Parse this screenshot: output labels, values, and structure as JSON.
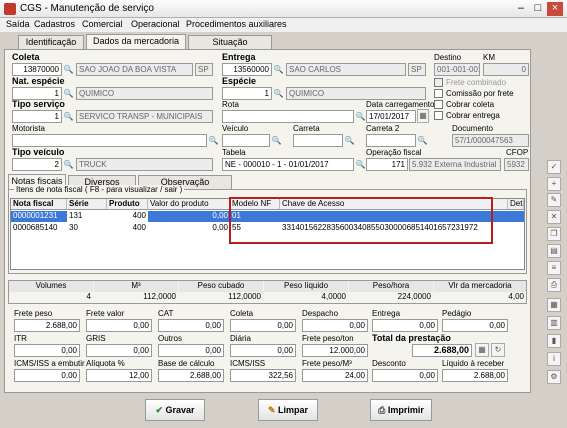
{
  "window": {
    "title": "CGS - Manutenção de serviço"
  },
  "menu": [
    "Saída",
    "Cadastros",
    "Comercial",
    "Operacional",
    "Procedimentos auxiliares"
  ],
  "tabs": [
    "Identificação",
    "Dados da mercadoria",
    "Situação"
  ],
  "coleta": {
    "label": "Coleta",
    "num": "13870000",
    "cidade": "SAO JOAO DA BOA VISTA",
    "uf": "SP"
  },
  "entrega": {
    "label": "Entrega",
    "num": "13560000",
    "cidade": "SAO CARLOS",
    "uf": "SP"
  },
  "destino": {
    "label": "Destino",
    "value": "001-001-001"
  },
  "km": {
    "label": "KM",
    "value": "0"
  },
  "nat_especie": {
    "label": "Nat. espécie",
    "code": "1",
    "value": "QUIMICO"
  },
  "especie": {
    "label": "Espécie",
    "code": "1",
    "value": "QUIMICO"
  },
  "checks": {
    "frete_combinado": "Frete combinado",
    "comissao": "Comissão por frete",
    "cobrar_coleta": "Cobrar coleta",
    "cobrar_entrega": "Cobrar entrega"
  },
  "tipo_servico": {
    "label": "Tipo serviço",
    "code": "1",
    "value": "SERVICO TRANSP - MUNICIPAIS"
  },
  "rota": {
    "label": "Rota"
  },
  "data_carregamento": {
    "label": "Data carregamento",
    "value": "17/01/2017"
  },
  "motorista": {
    "label": "Motorista"
  },
  "veiculo": {
    "label": "Veículo"
  },
  "carreta": {
    "label": "Carreta"
  },
  "carreta2": {
    "label": "Carreta 2"
  },
  "documento": {
    "label": "Documento",
    "value": "57/1/000047563"
  },
  "tipo_veiculo": {
    "label": "Tipo veículo",
    "code": "2",
    "value": "TRUCK"
  },
  "tabela": {
    "label": "Tabela",
    "value": "NE - 000010 - 1 - 01/01/2017"
  },
  "operacao_fiscal": {
    "label": "Operação fiscal",
    "code": "171",
    "value": "5.932 Externa Industrial 12"
  },
  "cfop": {
    "label": "CFOP",
    "value": "5932"
  },
  "subtabs": [
    "Notas fiscais",
    "Diversos",
    "Observação"
  ],
  "items_caption": "Itens de nota fiscal ( F8 - para visualizar / sair )",
  "grid": {
    "headers": [
      "Nota fiscal",
      "Série",
      "Produto",
      "Valor do produto",
      "Modelo NF",
      "Chave de Acesso",
      "Detalham"
    ],
    "rows": [
      [
        "0000001231",
        "131",
        "400",
        "0,00",
        "01",
        ""
      ],
      [
        "0000685140",
        "30",
        "400",
        "0,00",
        "55",
        "33140156228356003408550300006851401657231972"
      ]
    ]
  },
  "summary": {
    "headers": [
      "Volumes",
      "M³",
      "Peso cubado",
      "Peso líquido",
      "Peso/hora",
      "Vlr da mercadoria"
    ],
    "values": [
      "4",
      "112,0000",
      "112,0000",
      "4,0000",
      "224,0000",
      "4,00"
    ]
  },
  "values": {
    "row1": [
      {
        "label": "Frete peso",
        "value": "2.688,00"
      },
      {
        "label": "Frete valor",
        "value": "0,00"
      },
      {
        "label": "CAT",
        "value": "0,00"
      },
      {
        "label": "Coleta",
        "value": "0,00"
      },
      {
        "label": "Despacho",
        "value": "0,00"
      },
      {
        "label": "Entrega",
        "value": "0,00"
      },
      {
        "label": "Pedágio",
        "value": "0,00"
      }
    ],
    "row2": [
      {
        "label": "ITR",
        "value": "0,00"
      },
      {
        "label": "GRIS",
        "value": "0,00"
      },
      {
        "label": "Outros",
        "value": "0,00"
      },
      {
        "label": "Diária",
        "value": "0,00"
      },
      {
        "label": "Frete peso/ton",
        "value": "12.000,00"
      }
    ],
    "total": {
      "label": "Total da prestação",
      "value": "2.688,00"
    },
    "row3": [
      {
        "label": "ICMS/ISS a embutir",
        "value": "0,00"
      },
      {
        "label": "Alíquota %",
        "value": "12,00"
      },
      {
        "label": "Base de cálculo",
        "value": "2.688,00"
      },
      {
        "label": "ICMS/ISS",
        "value": "322,56"
      },
      {
        "label": "Frete peso/M³",
        "value": "24,00"
      },
      {
        "label": "Desconto",
        "value": "0,00"
      },
      {
        "label": "Líquido à receber",
        "value": "2.688,00"
      }
    ]
  },
  "buttons": {
    "gravar": "Gravar",
    "limpar": "Limpar",
    "imprimir": "Imprimir"
  },
  "colors": {
    "highlight": "#b81d1d",
    "selection": "#3b78d8"
  }
}
